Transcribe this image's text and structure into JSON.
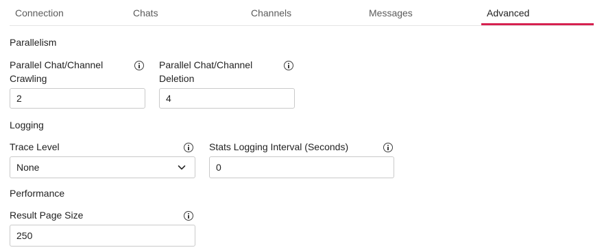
{
  "tabs": [
    {
      "label": "Connection",
      "active": false
    },
    {
      "label": "Chats",
      "active": false
    },
    {
      "label": "Channels",
      "active": false
    },
    {
      "label": "Messages",
      "active": false
    },
    {
      "label": "Advanced",
      "active": true
    }
  ],
  "accent_color": "#d6204f",
  "sections": {
    "parallelism": {
      "title": "Parallelism",
      "crawling": {
        "label": "Parallel Chat/Channel Crawling",
        "value": "2",
        "icon": "info-icon"
      },
      "deletion": {
        "label": "Parallel Chat/Channel Deletion",
        "value": "4",
        "icon": "info-icon"
      }
    },
    "logging": {
      "title": "Logging",
      "trace_level": {
        "label": "Trace Level",
        "selected": "None",
        "icon": "info-icon"
      },
      "stats_interval": {
        "label": "Stats Logging Interval (Seconds)",
        "value": "0",
        "icon": "info-icon"
      }
    },
    "performance": {
      "title": "Performance",
      "page_size": {
        "label": "Result Page Size",
        "value": "250",
        "icon": "info-icon"
      }
    }
  }
}
